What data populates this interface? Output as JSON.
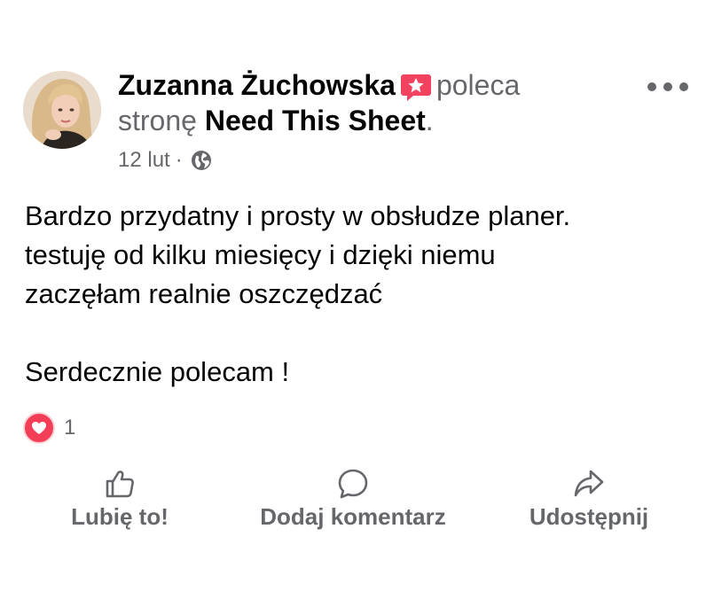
{
  "post": {
    "author": "Zuzanna Żuchowska",
    "action_text": "poleca",
    "action_text_2": "stronę",
    "page_name": "Need This Sheet",
    "period": ".",
    "date": "12 lut",
    "separator": "·",
    "privacy_icon": "globe-icon",
    "body_lines": [
      "Bardzo przydatny i prosty w obsłudze planer.",
      "testuję od kilku miesięcy i dzięki niemu",
      "zaczęłam realnie oszczędzać"
    ],
    "body_closing": "Serdecznie polecam !"
  },
  "reactions": {
    "icon": "love-reaction-icon",
    "count": "1"
  },
  "actions": {
    "like_label": "Lubię to!",
    "comment_label": "Dodaj komentarz",
    "share_label": "Udostępnij"
  },
  "colors": {
    "text_primary": "#050505",
    "text_secondary": "#65676b",
    "recommend_badge": "#f3425f",
    "love_reaction": "#f33e58"
  }
}
